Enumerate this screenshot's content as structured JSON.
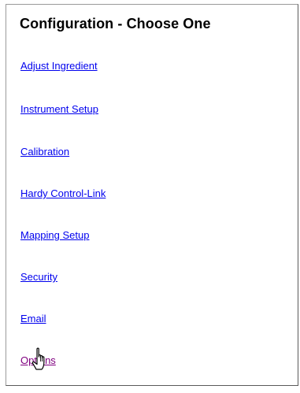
{
  "page": {
    "title": "Configuration - Choose One"
  },
  "menu": {
    "items": [
      {
        "label": "Adjust Ingredient"
      },
      {
        "label": "Instrument Setup"
      },
      {
        "label": "Calibration"
      },
      {
        "label": "Hardy Control-Link"
      },
      {
        "label": "Mapping Setup"
      },
      {
        "label": "Security"
      },
      {
        "label": "Email"
      },
      {
        "label": "Options"
      }
    ]
  },
  "colors": {
    "link": "#0000EE",
    "link_active": "#800080",
    "border": "#7a7a7a"
  },
  "cursor": {
    "icon": "hand-pointer-icon"
  }
}
